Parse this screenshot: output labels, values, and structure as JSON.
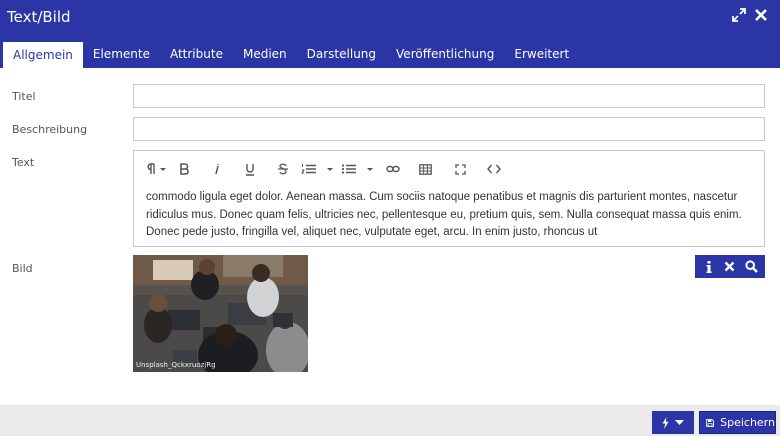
{
  "window": {
    "title": "Text/Bild"
  },
  "tabs": [
    {
      "label": "Allgemein",
      "active": true
    },
    {
      "label": "Elemente"
    },
    {
      "label": "Attribute"
    },
    {
      "label": "Medien"
    },
    {
      "label": "Darstellung"
    },
    {
      "label": "Veröffentlichung"
    },
    {
      "label": "Erweitert"
    }
  ],
  "form": {
    "titel_label": "Titel",
    "titel_value": "",
    "beschreibung_label": "Beschreibung",
    "beschreibung_value": "",
    "text_label": "Text",
    "text_content": "commodo ligula eget dolor. Aenean massa. Cum sociis natoque penatibus et magnis dis parturient montes, nascetur ridiculus mus. Donec quam felis, ultricies nec, pellentesque eu, pretium quis, sem. Nulla consequat massa quis enim. Donec pede justo, fringilla vel, aliquet nec, vulputate eget, arcu. In enim justo, rhoncus ut",
    "bild_label": "Bild",
    "image_caption": "Unsplash_QckxruozjRg"
  },
  "toolbar_icons": [
    "paragraph-icon",
    "bold-icon",
    "italic-icon",
    "underline-icon",
    "strikethrough-icon",
    "ordered-list-icon",
    "unordered-list-icon",
    "link-icon",
    "table-icon",
    "fullscreen-icon",
    "code-icon"
  ],
  "footer": {
    "save_label": "Speichern"
  },
  "colors": {
    "primary": "#2b35a6",
    "footer_bg": "#ebebeb",
    "border": "#c9c9c9"
  }
}
